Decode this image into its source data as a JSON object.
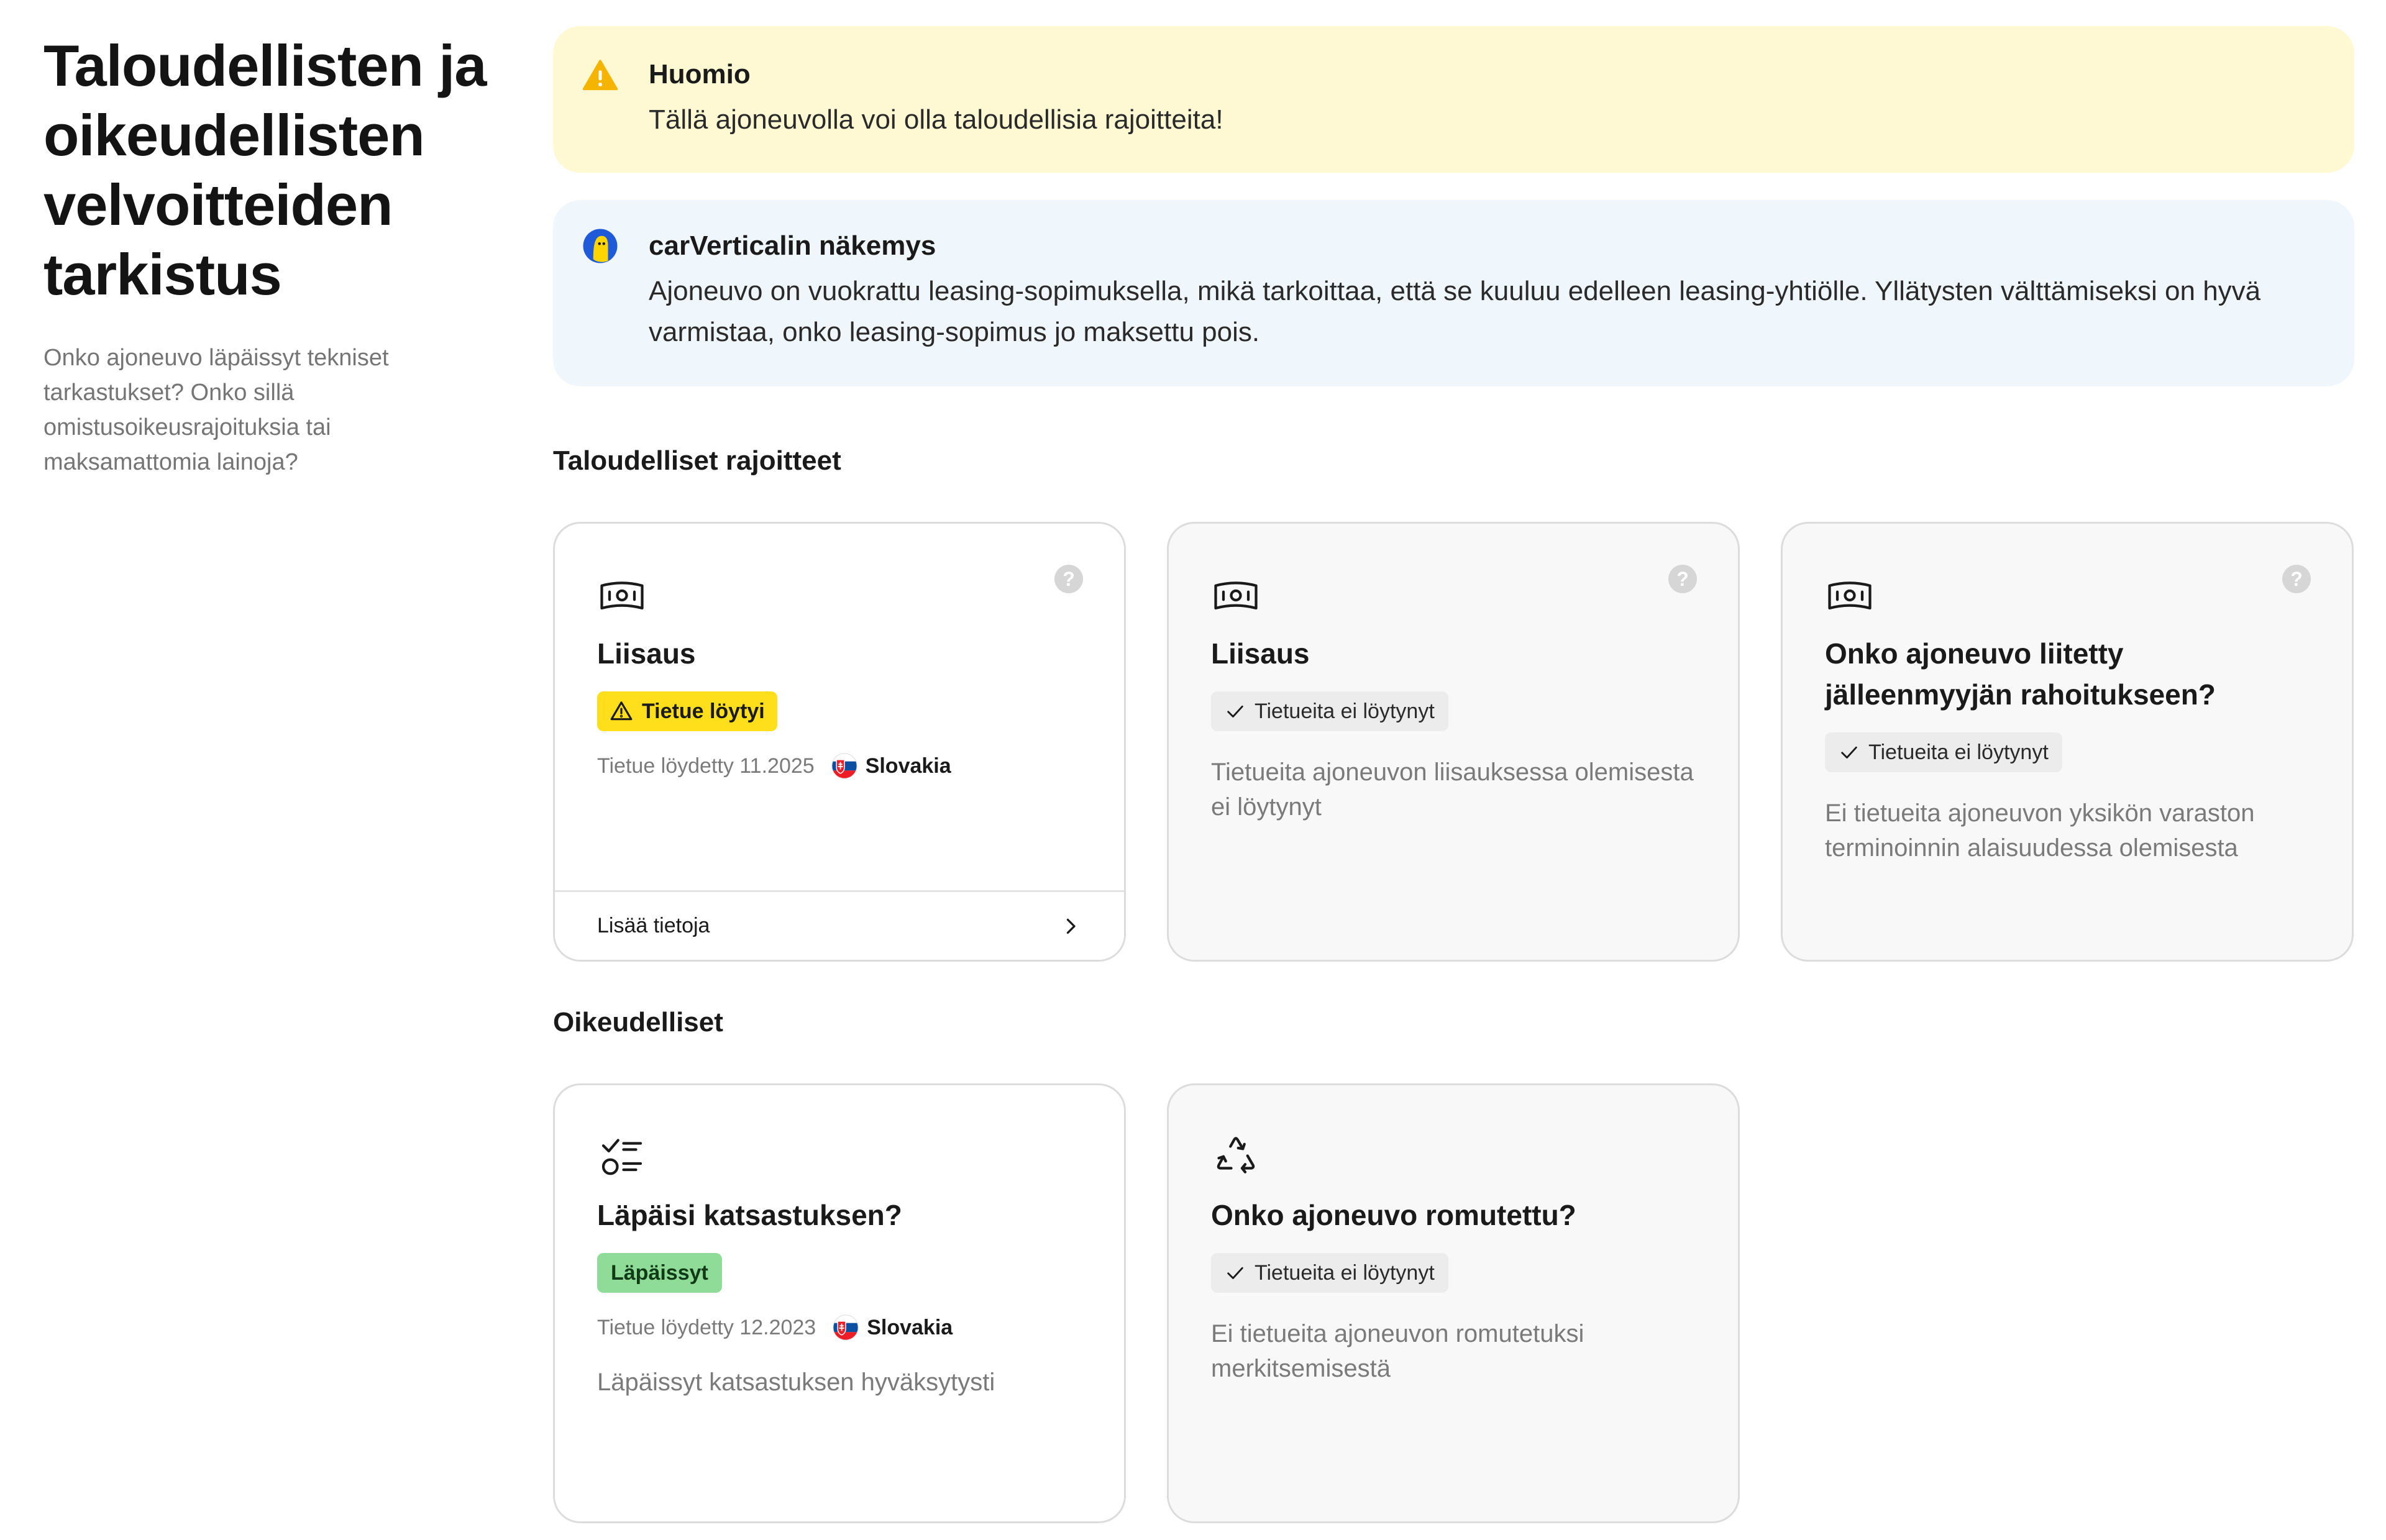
{
  "sidebar": {
    "title": "Taloudellisten ja oikeudellisten velvoitteiden tarkistus",
    "description": "Onko ajoneuvo läpäissyt tekniset tarkastukset? Onko sillä omistusoikeusrajoituksia tai maksamattomia lainoja?"
  },
  "warning": {
    "title": "Huomio",
    "text": "Tällä ajoneuvolla voi olla taloudellisia rajoitteita!",
    "color": "#f5b400"
  },
  "insight": {
    "title": "carVerticalin näkemys",
    "text": "Ajoneuvo on vuokrattu leasing-sopimuksella, mikä tarkoittaa, että se kuuluu edelleen leasing-yhtiölle. Yllätysten välttämiseksi on hyvä varmistaa, onko leasing-sopimus jo maksettu pois."
  },
  "financial": {
    "title": "Taloudelliset rajoitteet",
    "cards": [
      {
        "icon": "cash-icon",
        "title": "Liisaus",
        "badge": "Tietue löytyi",
        "found_date": "Tietue löydetty 11.2025",
        "country": "Slovakia",
        "link": "Lisää tietoja"
      },
      {
        "icon": "cash-icon",
        "title": "Liisaus",
        "badge": "Tietueita ei löytynyt",
        "description": "Tietueita ajoneuvon liisauksessa olemisesta ei löytynyt"
      },
      {
        "icon": "cash-icon",
        "title": "Onko ajoneuvo liitetty jälleenmyyjän rahoitukseen?",
        "badge": "Tietueita ei löytynyt",
        "description": "Ei tietueita ajoneuvon yksikön varaston terminoinnin alaisuudessa olemisesta"
      }
    ]
  },
  "legal": {
    "title": "Oikeudelliset",
    "cards": [
      {
        "icon": "checklist-icon",
        "title": "Läpäisi katsastuksen?",
        "badge": "Läpäissyt",
        "found_date": "Tietue löydetty 12.2023",
        "country": "Slovakia",
        "description": "Läpäissyt katsastuksen hyväksytysti"
      },
      {
        "icon": "recycle-icon",
        "title": "Onko ajoneuvo romutettu?",
        "badge": "Tietueita ei löytynyt",
        "description": "Ei tietueita ajoneuvon romutetuksi merkitsemisestä"
      }
    ]
  },
  "help_label": "?"
}
